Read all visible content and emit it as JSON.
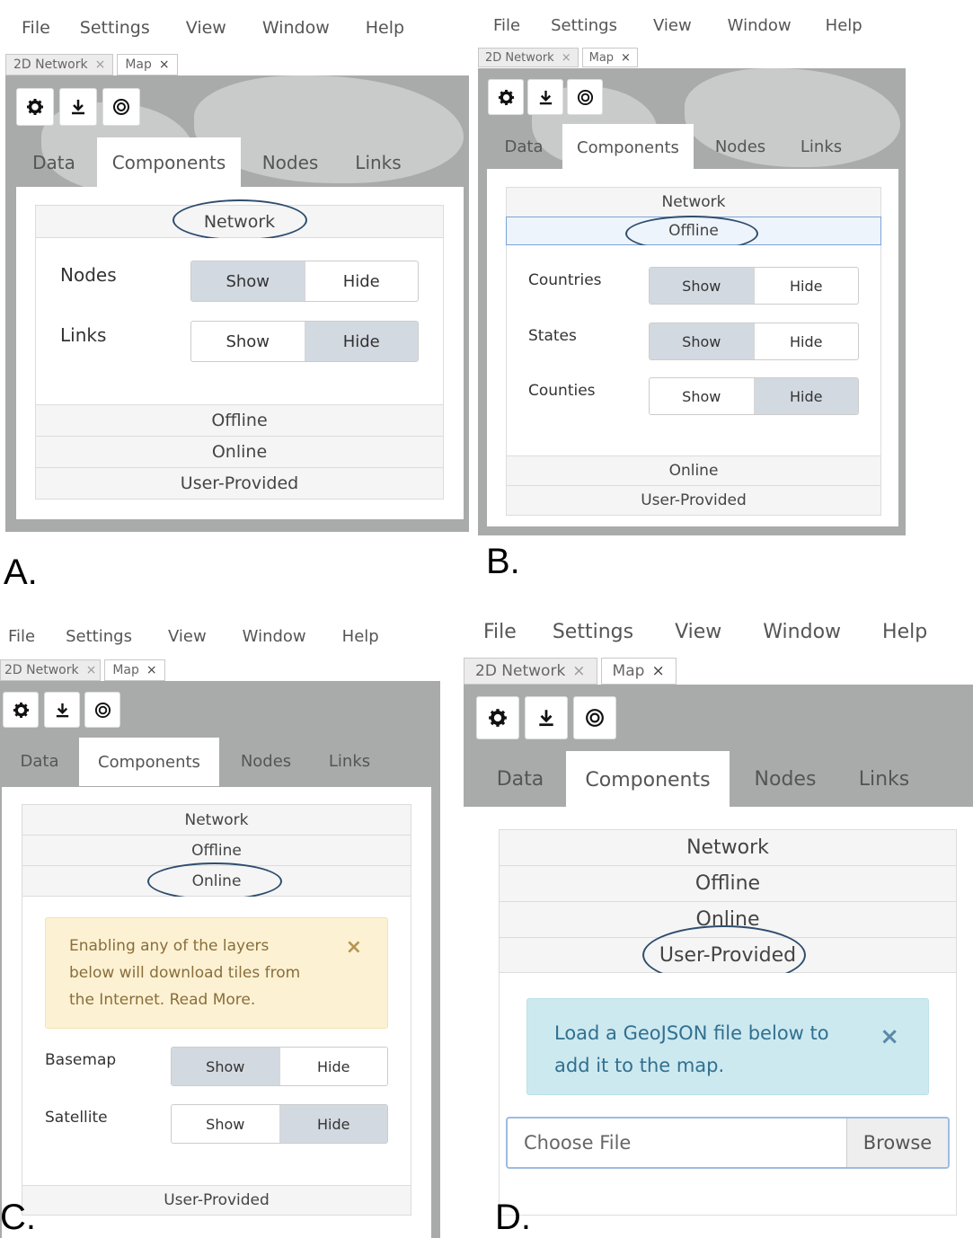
{
  "menu": [
    "File",
    "Settings",
    "View",
    "Window",
    "Help"
  ],
  "window_tabs": [
    {
      "label": "2D Network",
      "close": "×"
    },
    {
      "label": "Map",
      "close": "×"
    }
  ],
  "tool_icons": [
    "gear-icon",
    "download-icon",
    "target-icon"
  ],
  "panel_tabs": [
    "Data",
    "Components",
    "Nodes",
    "Links"
  ],
  "panels": {
    "a": {
      "letter": "A.",
      "accordion": {
        "network": "Network",
        "offline": "Offline",
        "online": "Online",
        "user_provided": "User-Provided"
      },
      "rows": [
        {
          "label": "Nodes",
          "show": "Show",
          "hide": "Hide",
          "state": "Show"
        },
        {
          "label": "Links",
          "show": "Show",
          "hide": "Hide",
          "state": "Hide"
        }
      ]
    },
    "b": {
      "letter": "B.",
      "accordion": {
        "network": "Network",
        "offline": "Offline",
        "online": "Online",
        "user_provided": "User-Provided"
      },
      "rows": [
        {
          "label": "Countries",
          "show": "Show",
          "hide": "Hide",
          "state": "Show"
        },
        {
          "label": "States",
          "show": "Show",
          "hide": "Hide",
          "state": "Show"
        },
        {
          "label": "Counties",
          "show": "Show",
          "hide": "Hide",
          "state": "Hide"
        }
      ]
    },
    "c": {
      "letter": "C.",
      "accordion": {
        "network": "Network",
        "offline": "Offline",
        "online": "Online",
        "user_provided": "User-Provided"
      },
      "alert": {
        "line1": "Enabling any of the layers",
        "line2": "below will download tiles from",
        "line3": "the Internet. Read More.",
        "close": "×"
      },
      "rows": [
        {
          "label": "Basemap",
          "show": "Show",
          "hide": "Hide",
          "state": "Show"
        },
        {
          "label": "Satellite",
          "show": "Show",
          "hide": "Hide",
          "state": "Hide"
        }
      ]
    },
    "d": {
      "letter": "D.",
      "accordion": {
        "network": "Network",
        "offline": "Offline",
        "online": "Online",
        "user_provided": "User-Provided"
      },
      "alert": {
        "line1": "Load a GeoJSON file below to",
        "line2": "add it to the map.",
        "close": "×"
      },
      "file": {
        "placeholder": "Choose File",
        "button": "Browse"
      }
    }
  },
  "colors": {
    "active_toggle": "#d3d9e1",
    "map_gray": "#a9abab",
    "warn_bg": "#fcf2d3",
    "info_bg": "#cde9f0",
    "oval": "#2e4d6e"
  }
}
